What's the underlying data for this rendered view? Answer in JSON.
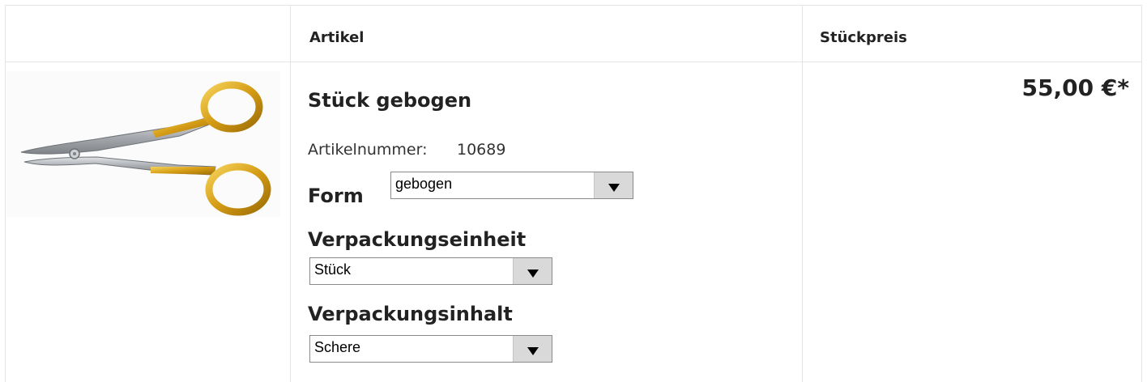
{
  "table": {
    "headers": {
      "article": "Artikel",
      "unit_price": "Stückpreis"
    }
  },
  "product": {
    "image_icon": "scissors-image",
    "name": "Stück gebogen",
    "sku_label": "Artikelnummer:",
    "sku_value": "10689",
    "variants": {
      "form": {
        "label": "Form",
        "selected": "gebogen"
      },
      "packaging_unit": {
        "label": "Verpackungseinheit",
        "selected": "Stück"
      },
      "packaging_content": {
        "label": "Verpackungsinhalt",
        "selected": "Schere"
      }
    },
    "price": "55,00 €*"
  },
  "colors": {
    "gold": "#d9a520",
    "steel": "#b9bcc0",
    "border": "#e4e4e4",
    "select_button": "#d9d9d9"
  }
}
